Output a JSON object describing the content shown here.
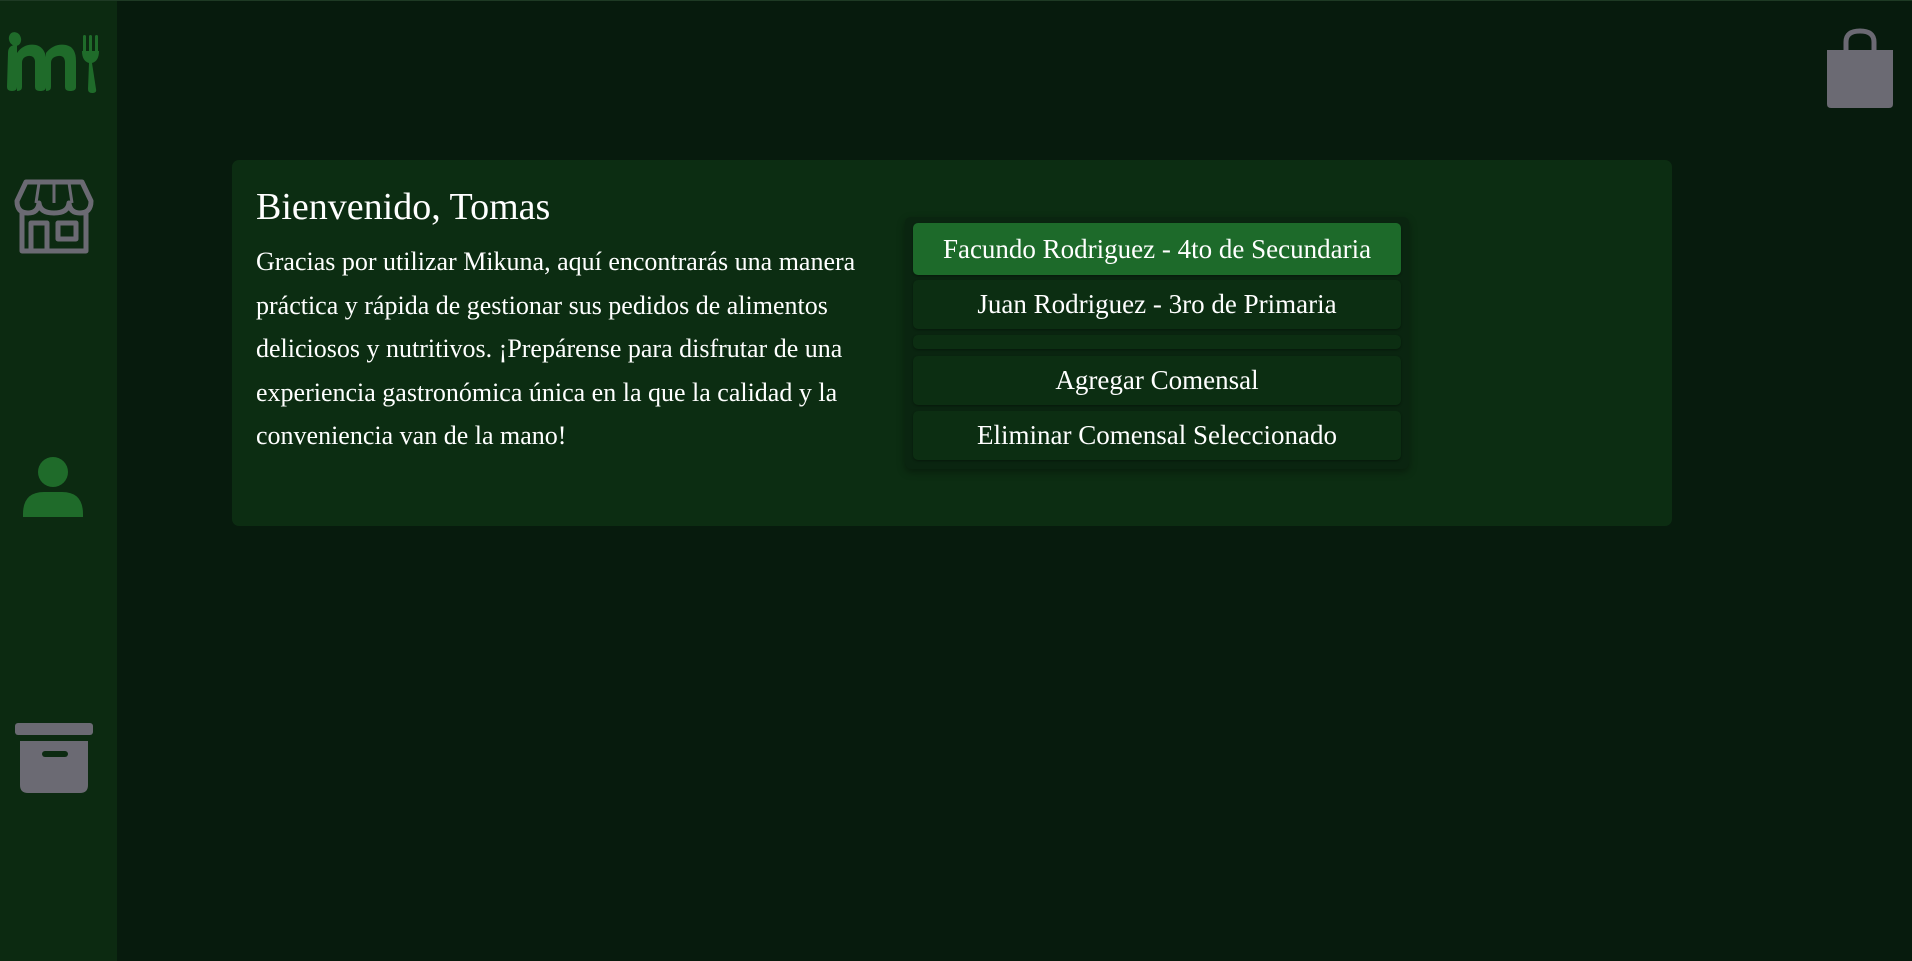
{
  "app": {
    "name": "Mikuna",
    "logo_icon": "mikuna-logo-icon"
  },
  "colors": {
    "background": "#071b0d",
    "sidebar": "#0c2a11",
    "card": "#0c2d12",
    "selected_item": "#1d6a2a",
    "logo_green": "#1f6b2a",
    "icon_gray": "#6b6a73"
  },
  "sidebar": {
    "items": [
      {
        "icon": "store-icon",
        "active": false
      },
      {
        "icon": "user-icon",
        "active": true
      },
      {
        "icon": "archive-icon",
        "active": false
      }
    ]
  },
  "header": {
    "cart_icon": "shopping-bag-icon"
  },
  "welcome": {
    "title": "Bienvenido, Tomas",
    "message": "Gracias por utilizar Mikuna, aquí encontrarás una manera práctica y rápida de gestionar sus pedidos de alimentos deliciosos y nutritivos. ¡Prepárense para disfrutar de una experiencia gastronómica única en la que la calidad y la conveniencia van de la mano!"
  },
  "diners": {
    "items": [
      {
        "label": "Facundo Rodriguez - 4to de Secundaria",
        "selected": true
      },
      {
        "label": "Juan Rodriguez - 3ro de Primaria",
        "selected": false
      },
      {
        "label": "",
        "selected": false
      }
    ],
    "add_label": "Agregar Comensal",
    "remove_label": "Eliminar Comensal Seleccionado"
  }
}
